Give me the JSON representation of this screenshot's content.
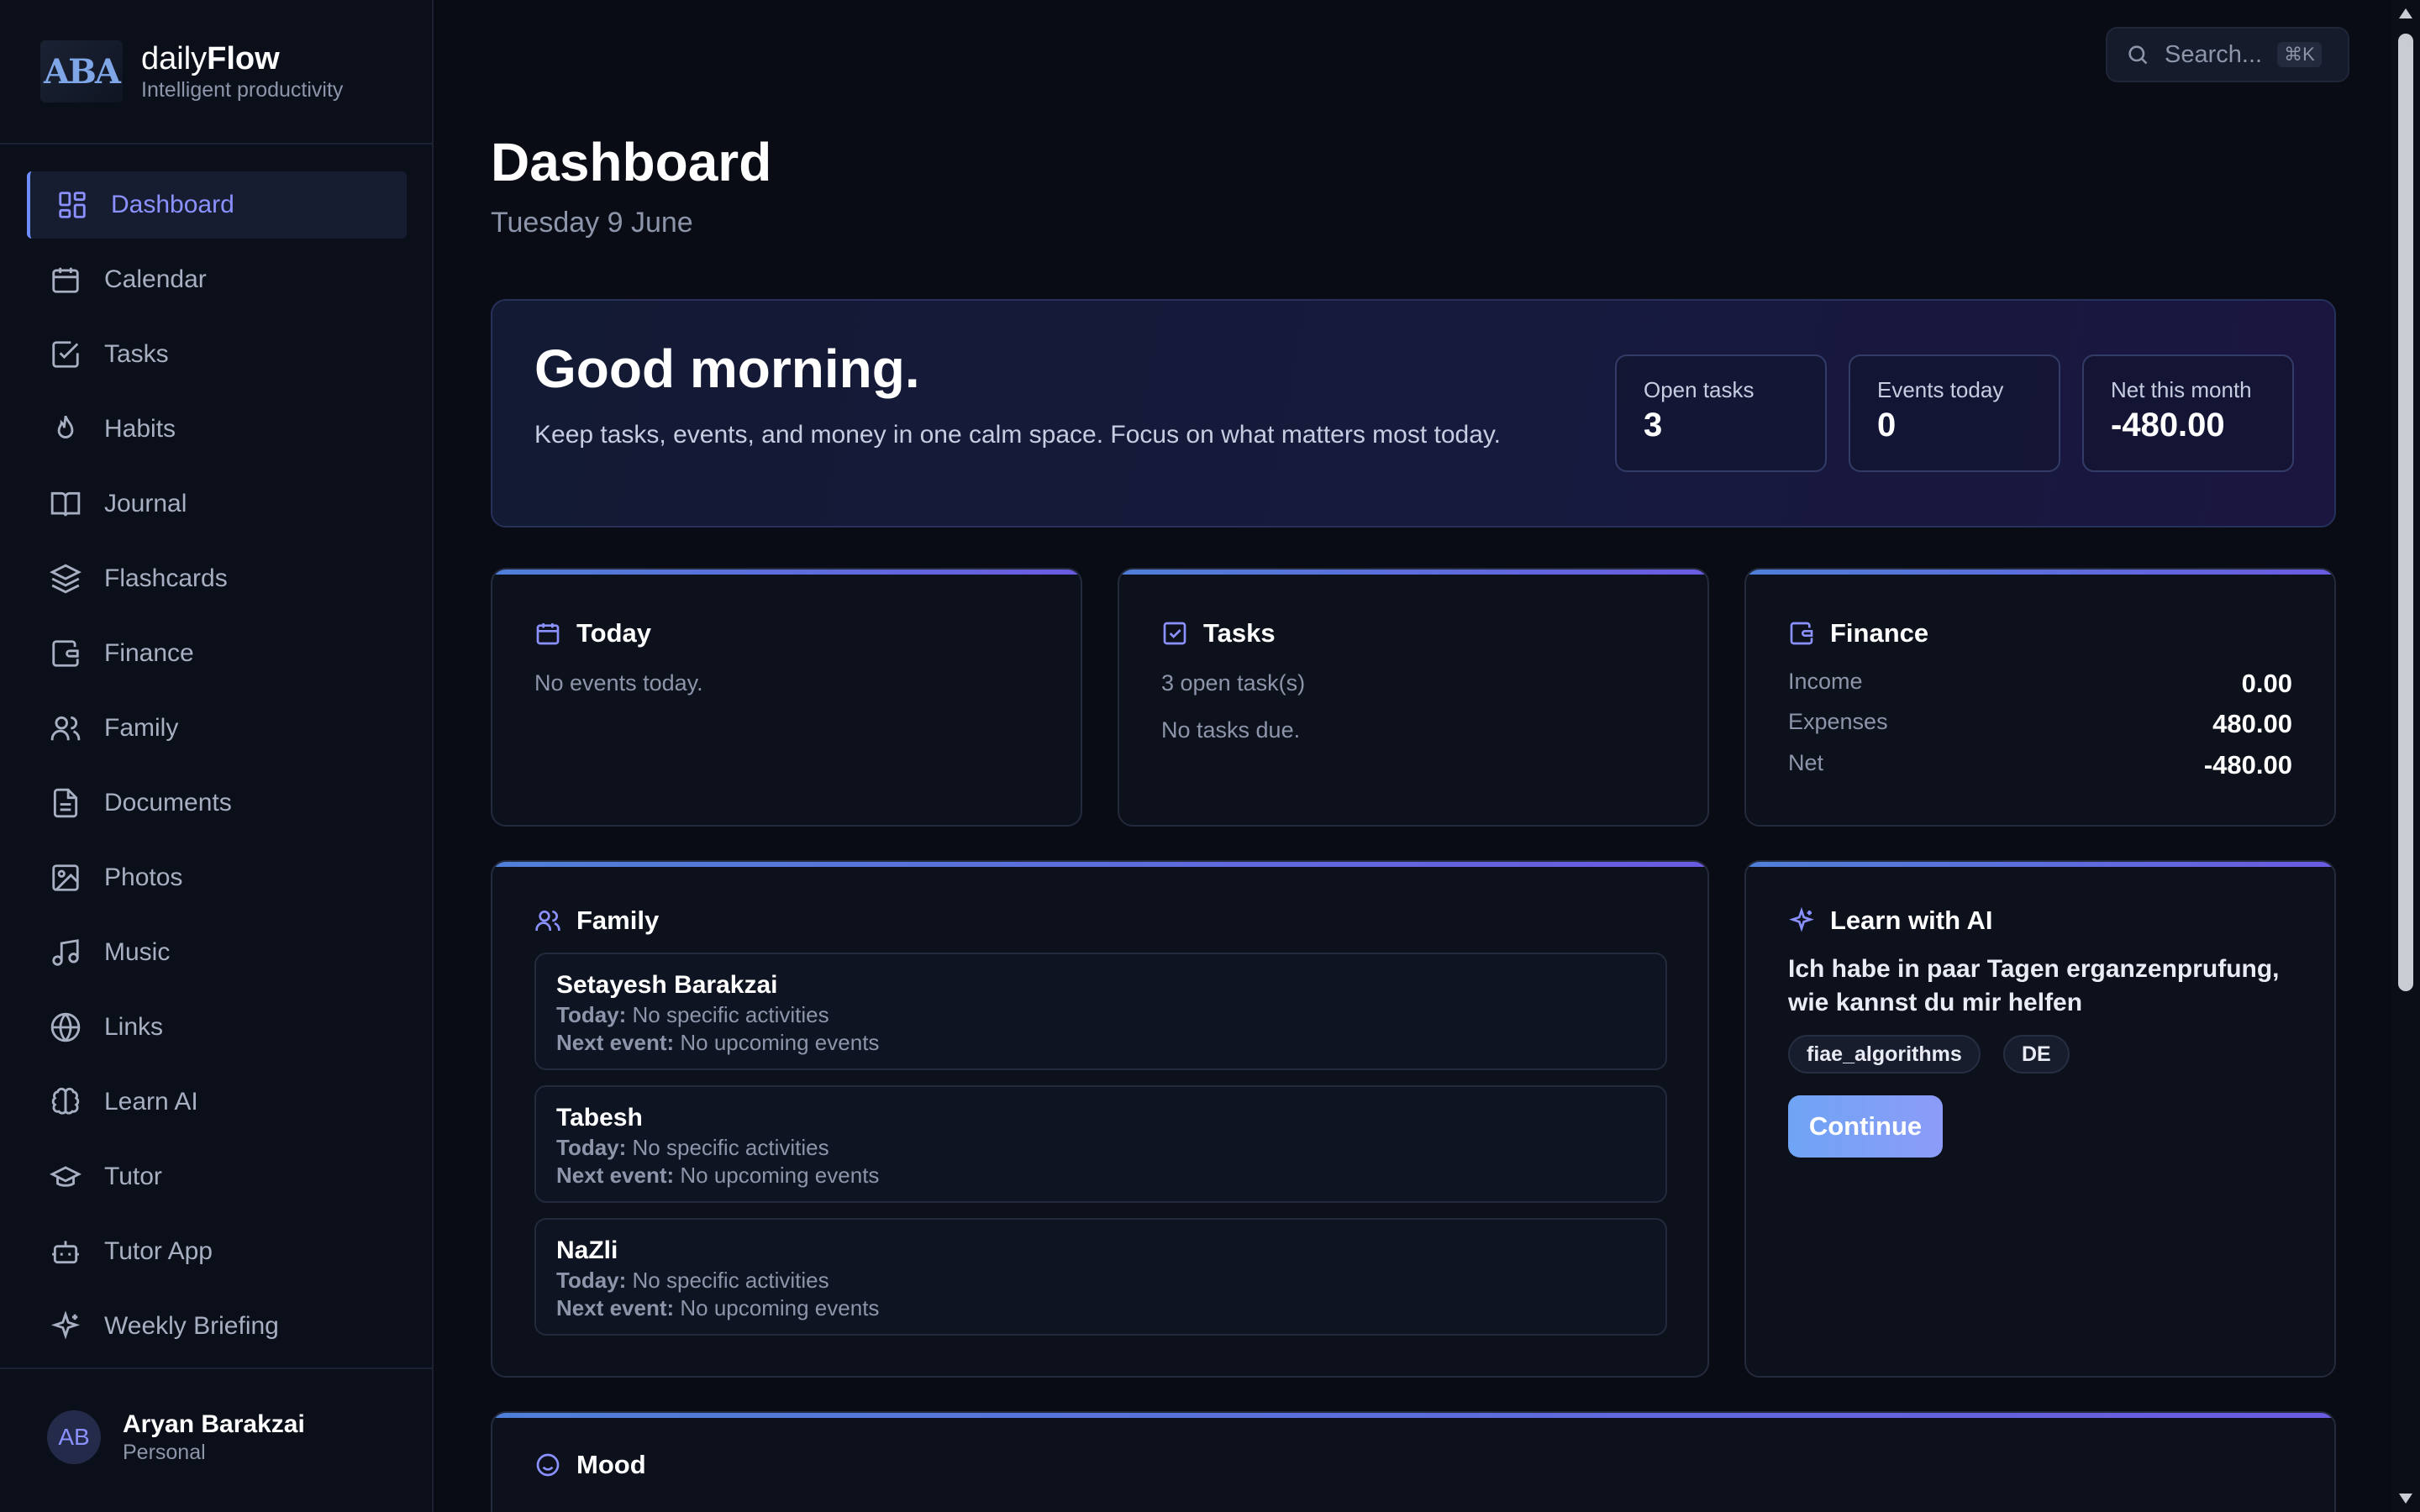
{
  "brand": {
    "name_prefix": "daily",
    "name_bold": "Flow",
    "subtitle": "Intelligent productivity",
    "logo_text": "ABA"
  },
  "nav": {
    "items": [
      {
        "label": "Dashboard",
        "icon": "dashboard-icon"
      },
      {
        "label": "Calendar",
        "icon": "calendar-icon"
      },
      {
        "label": "Tasks",
        "icon": "checkbox-icon"
      },
      {
        "label": "Habits",
        "icon": "flame-icon"
      },
      {
        "label": "Journal",
        "icon": "book-icon"
      },
      {
        "label": "Flashcards",
        "icon": "layers-icon"
      },
      {
        "label": "Finance",
        "icon": "wallet-icon"
      },
      {
        "label": "Family",
        "icon": "users-icon"
      },
      {
        "label": "Documents",
        "icon": "document-icon"
      },
      {
        "label": "Photos",
        "icon": "image-icon"
      },
      {
        "label": "Music",
        "icon": "music-icon"
      },
      {
        "label": "Links",
        "icon": "globe-icon"
      },
      {
        "label": "Learn AI",
        "icon": "brain-icon"
      },
      {
        "label": "Tutor",
        "icon": "graduation-cap-icon"
      },
      {
        "label": "Tutor App",
        "icon": "bot-icon"
      },
      {
        "label": "Weekly Briefing",
        "icon": "sparkles-icon"
      }
    ],
    "active": "Dashboard"
  },
  "user": {
    "initials": "AB",
    "name": "Aryan Barakzai",
    "role": "Personal"
  },
  "search": {
    "placeholder": "Search...",
    "shortcut": "⌘K"
  },
  "header": {
    "title": "Dashboard",
    "date": "Tuesday 9 June"
  },
  "hero": {
    "greeting": "Good morning.",
    "text": "Keep tasks, events, and money in one calm space. Focus on what matters most today.",
    "stats": [
      {
        "label": "Open tasks",
        "value": "3"
      },
      {
        "label": "Events today",
        "value": "0"
      },
      {
        "label": "Net this month",
        "value": "-480.00"
      }
    ]
  },
  "today": {
    "title": "Today",
    "empty": "No events today."
  },
  "tasks": {
    "title": "Tasks",
    "open": "3 open task(s)",
    "due": "No tasks due."
  },
  "finance": {
    "title": "Finance",
    "rows": [
      {
        "label": "Income",
        "value": "0.00"
      },
      {
        "label": "Expenses",
        "value": "480.00"
      },
      {
        "label": "Net",
        "value": "-480.00"
      }
    ]
  },
  "family": {
    "title": "Family",
    "today_label": "Today:",
    "next_label": "Next event:",
    "members": [
      {
        "name": "Setayesh Barakzai",
        "today": "No specific activities",
        "next": "No upcoming events"
      },
      {
        "name": "Tabesh",
        "today": "No specific activities",
        "next": "No upcoming events"
      },
      {
        "name": "NaZli",
        "today": "No specific activities",
        "next": "No upcoming events"
      }
    ]
  },
  "learn_ai": {
    "title": "Learn with AI",
    "prompt": "Ich habe in paar Tagen erganzenprufung, wie kannst du mir helfen",
    "chips": [
      "fiae_algorithms",
      "DE"
    ],
    "button": "Continue"
  },
  "mood": {
    "title": "Mood"
  },
  "colors": {
    "accent": "#8b91ff",
    "background": "#090c14",
    "card": "#0d111c"
  }
}
